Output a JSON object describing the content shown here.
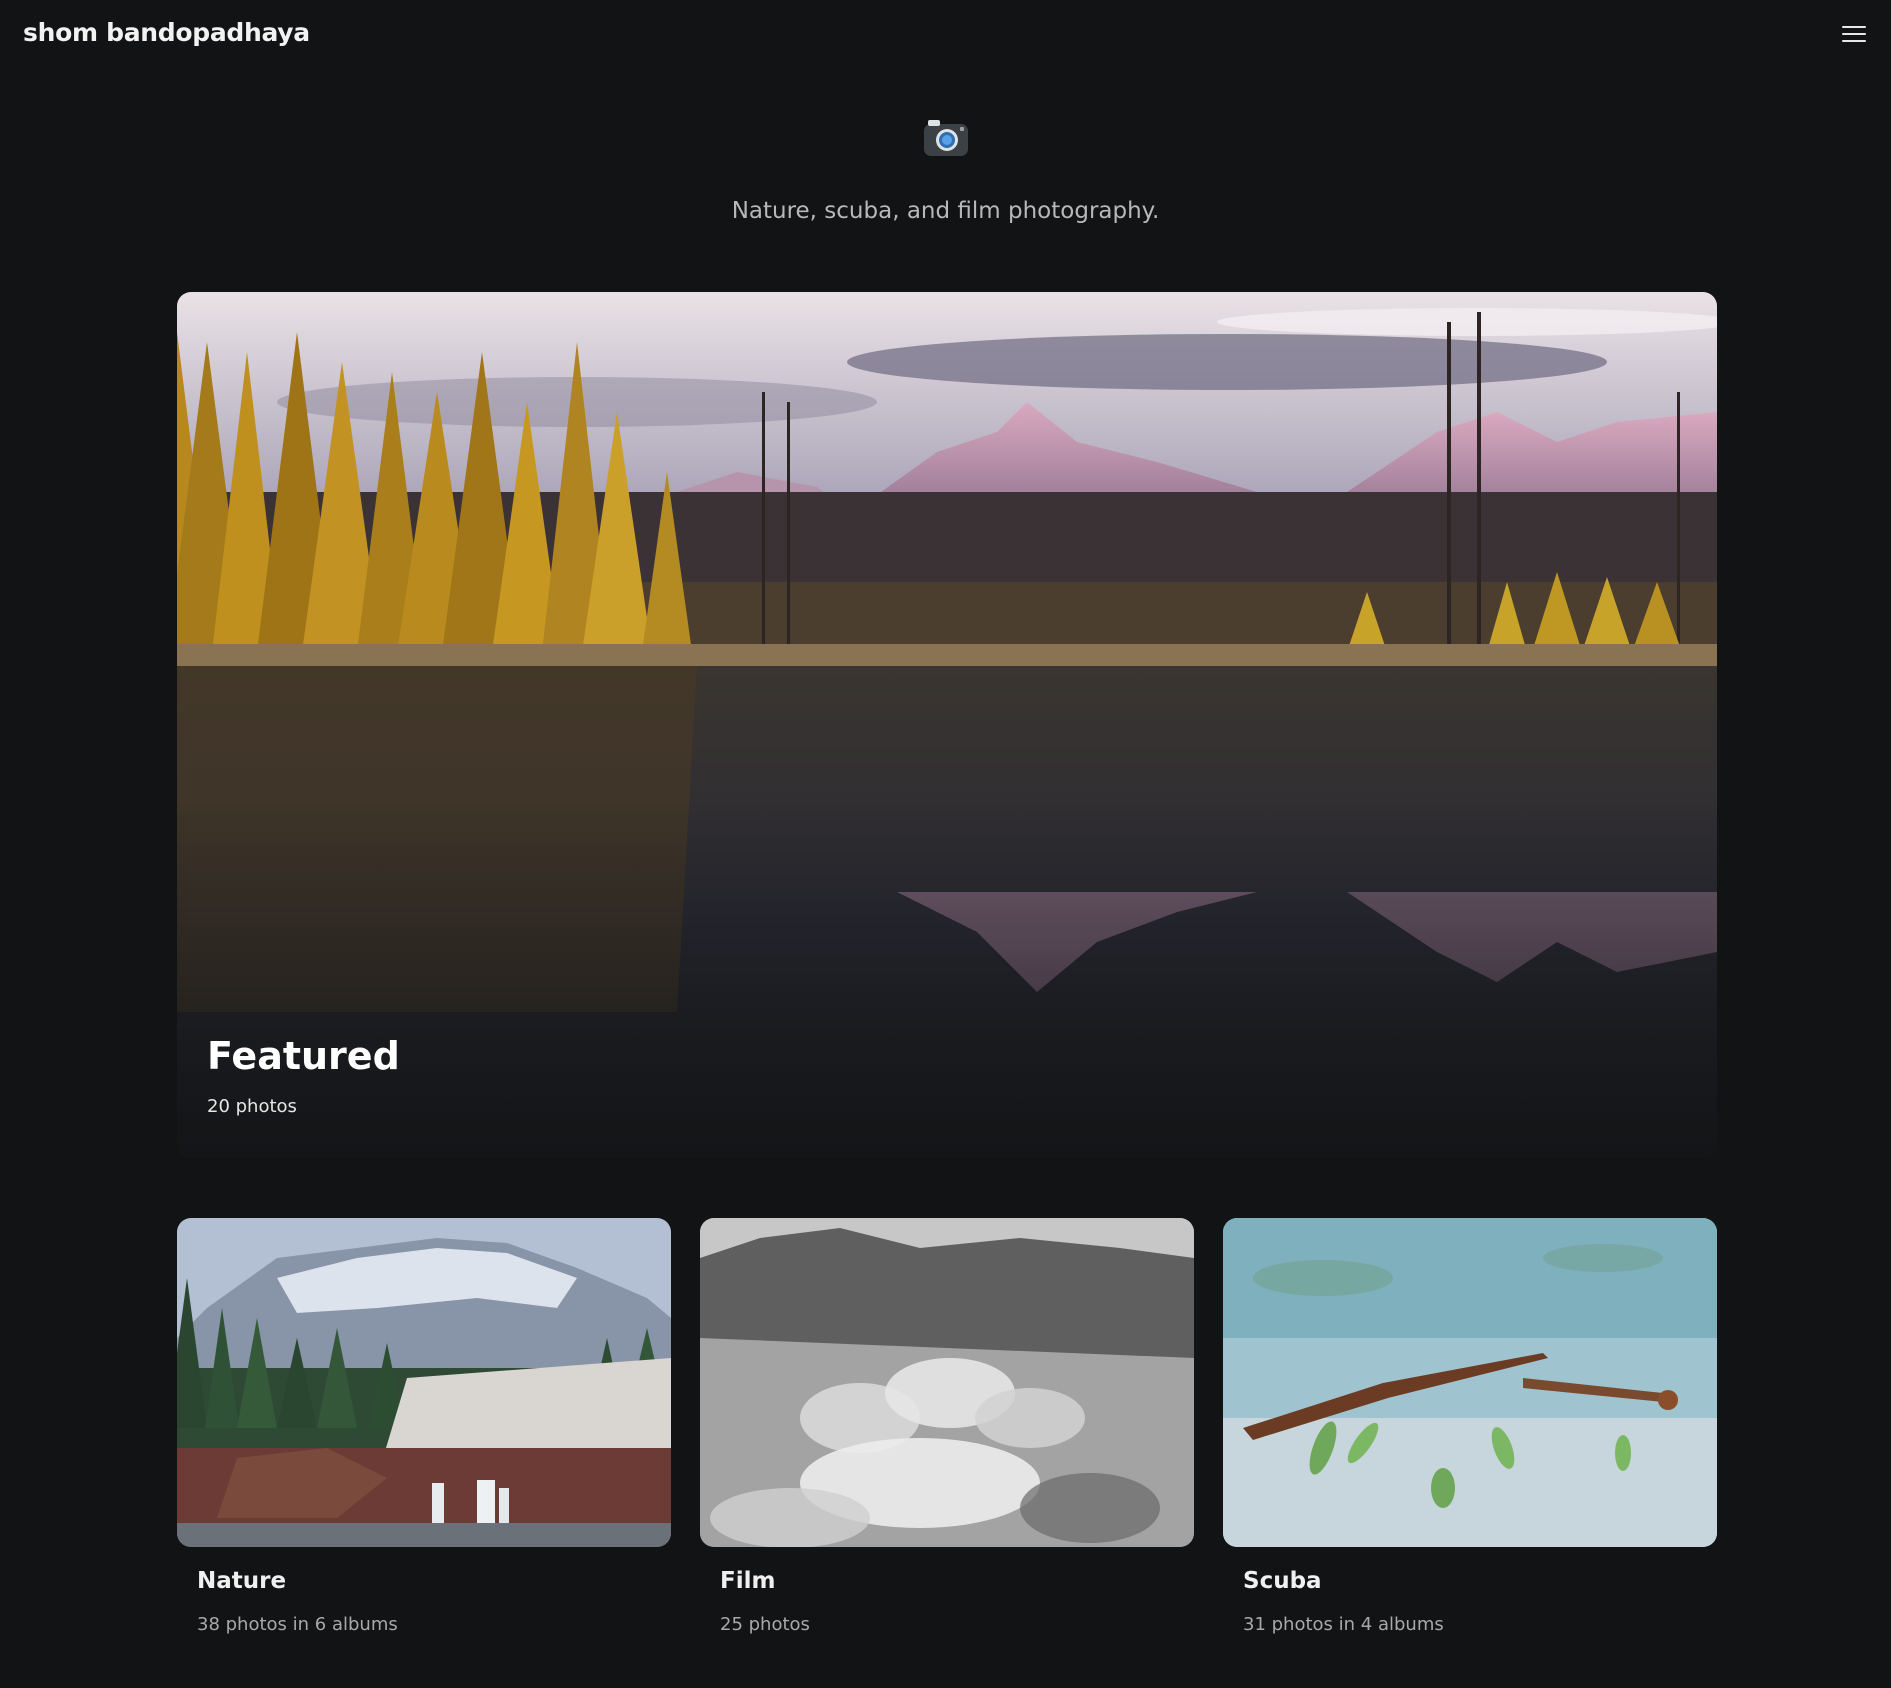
{
  "site": {
    "title": "shom bandopadhaya",
    "tagline": "Nature, scuba, and film photography.",
    "menu_icon": "hamburger-menu-icon",
    "hero_icon": "camera-icon"
  },
  "featured": {
    "title": "Featured",
    "count": "20 photos"
  },
  "albums": [
    {
      "title": "Nature",
      "count": "38 photos in 6 albums"
    },
    {
      "title": "Film",
      "count": "25 photos"
    },
    {
      "title": "Scuba",
      "count": "31 photos in 4 albums"
    }
  ],
  "colors": {
    "background": "#111314",
    "text_primary": "#f0f0f0",
    "text_secondary": "#a9a9a9"
  }
}
